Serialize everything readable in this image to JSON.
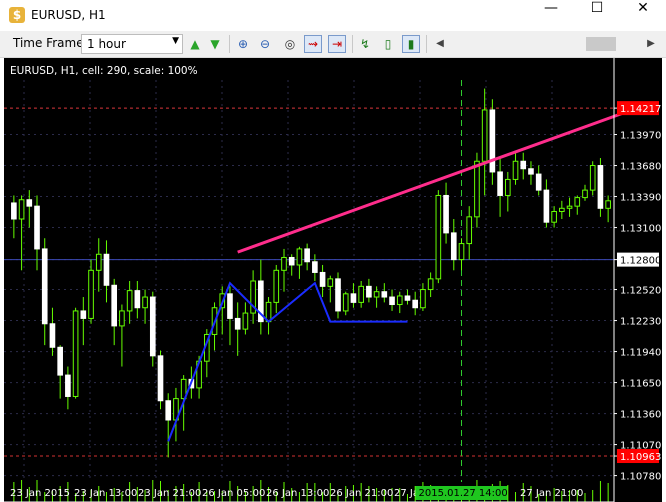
{
  "window": {
    "title": "EURUSD, H1",
    "app_icon": "dollar-coin-icon",
    "controls": [
      "minimize",
      "maximize",
      "close"
    ]
  },
  "toolbar": {
    "time_frame_label": "Time Frame:",
    "time_frame_value": "1 hour",
    "icons": [
      "arrow-up-green-icon",
      "arrow-down-green-icon",
      "zoom-in-icon",
      "zoom-out-icon",
      "binoculars-icon",
      "chart-shift-icon",
      "autoscroll-icon",
      "line-chart-icon",
      "bar-chart-icon",
      "candlestick-chart-icon",
      "scroll-left-icon",
      "scroll-right-icon"
    ]
  },
  "chart": {
    "header": "EURUSD, H1, cell: 290, scale: 100%",
    "price_labels": [
      "1.14217",
      "1.13970",
      "1.13680",
      "1.13390",
      "1.13100",
      "1.12800",
      "1.12520",
      "1.12230",
      "1.11940",
      "1.11650",
      "1.11360",
      "1.11070",
      "1.10963",
      "1.10780"
    ],
    "highlighted_prices": {
      "top": "1.14217",
      "bottom": "1.10963",
      "current": "1.12800"
    },
    "time_labels": [
      "23 Jan 2015",
      "23 Jan 13:00",
      "23 Jan 21:00",
      "26 Jan 05:00",
      "26 Jan 13:00",
      "26 Jan 21:00",
      "27 Jan",
      "27 Jan 21:00"
    ],
    "crosshair_time": "2015.01.27 14:00",
    "colors": {
      "background": "#000000",
      "candle": "#66ff00",
      "trendline": "#ff2d8c",
      "drawing": "#1a2cff",
      "hline_red": "#d23232",
      "hline_blue": "#3c4ab4",
      "crosshair": "#2ecc2e",
      "price_highlight_red": "#ff0000",
      "price_highlight_white": "#ffffff"
    }
  },
  "chart_data": {
    "type": "candlestick",
    "symbol": "EURUSD",
    "timeframe": "H1",
    "ylim": [
      1.1072,
      1.1448
    ],
    "candles": [
      [
        1.1333,
        1.134,
        1.13,
        1.1318
      ],
      [
        1.1318,
        1.134,
        1.127,
        1.1336
      ],
      [
        1.1336,
        1.1345,
        1.131,
        1.133
      ],
      [
        1.133,
        1.134,
        1.127,
        1.129
      ],
      [
        1.129,
        1.13,
        1.12,
        1.122
      ],
      [
        1.122,
        1.1235,
        1.119,
        1.1198
      ],
      [
        1.1198,
        1.12,
        1.115,
        1.1172
      ],
      [
        1.1172,
        1.118,
        1.114,
        1.1152
      ],
      [
        1.1152,
        1.1235,
        1.115,
        1.1232
      ],
      [
        1.1232,
        1.1245,
        1.12,
        1.1225
      ],
      [
        1.1225,
        1.128,
        1.122,
        1.127
      ],
      [
        1.127,
        1.13,
        1.125,
        1.1285
      ],
      [
        1.1285,
        1.1298,
        1.124,
        1.1256
      ],
      [
        1.1256,
        1.1262,
        1.12,
        1.1218
      ],
      [
        1.1218,
        1.1238,
        1.118,
        1.1232
      ],
      [
        1.1232,
        1.126,
        1.122,
        1.1251
      ],
      [
        1.1251,
        1.126,
        1.1225,
        1.1235
      ],
      [
        1.1235,
        1.1252,
        1.122,
        1.1245
      ],
      [
        1.1245,
        1.125,
        1.118,
        1.119
      ],
      [
        1.119,
        1.1195,
        1.114,
        1.1148
      ],
      [
        1.1148,
        1.1155,
        1.1095,
        1.113
      ],
      [
        1.113,
        1.116,
        1.111,
        1.115
      ],
      [
        1.115,
        1.1172,
        1.112,
        1.1168
      ],
      [
        1.1168,
        1.118,
        1.115,
        1.116
      ],
      [
        1.116,
        1.119,
        1.115,
        1.1185
      ],
      [
        1.1185,
        1.1215,
        1.117,
        1.121
      ],
      [
        1.121,
        1.124,
        1.1195,
        1.1235
      ],
      [
        1.1235,
        1.1255,
        1.121,
        1.1248
      ],
      [
        1.1248,
        1.1255,
        1.12,
        1.1225
      ],
      [
        1.1225,
        1.124,
        1.119,
        1.1215
      ],
      [
        1.1215,
        1.124,
        1.121,
        1.123
      ],
      [
        1.123,
        1.127,
        1.122,
        1.126
      ],
      [
        1.126,
        1.128,
        1.121,
        1.1222
      ],
      [
        1.1222,
        1.1245,
        1.121,
        1.124
      ],
      [
        1.124,
        1.1275,
        1.123,
        1.127
      ],
      [
        1.127,
        1.129,
        1.125,
        1.1282
      ],
      [
        1.1282,
        1.1285,
        1.1265,
        1.1275
      ],
      [
        1.1275,
        1.1292,
        1.1262,
        1.129
      ],
      [
        1.129,
        1.1295,
        1.127,
        1.1278
      ],
      [
        1.1278,
        1.1285,
        1.126,
        1.1268
      ],
      [
        1.1268,
        1.1275,
        1.1245,
        1.1255
      ],
      [
        1.1255,
        1.1265,
        1.124,
        1.1262
      ],
      [
        1.1262,
        1.1268,
        1.1225,
        1.1232
      ],
      [
        1.1232,
        1.125,
        1.1228,
        1.1248
      ],
      [
        1.1248,
        1.1258,
        1.1235,
        1.124
      ],
      [
        1.124,
        1.126,
        1.1235,
        1.1255
      ],
      [
        1.1255,
        1.1262,
        1.124,
        1.1245
      ],
      [
        1.1245,
        1.1255,
        1.1235,
        1.125
      ],
      [
        1.125,
        1.1258,
        1.124,
        1.1245
      ],
      [
        1.1245,
        1.1252,
        1.1232,
        1.1238
      ],
      [
        1.1238,
        1.125,
        1.123,
        1.1246
      ],
      [
        1.1246,
        1.1252,
        1.1238,
        1.1242
      ],
      [
        1.1242,
        1.125,
        1.1228,
        1.1235
      ],
      [
        1.1235,
        1.1258,
        1.1232,
        1.1252
      ],
      [
        1.1252,
        1.1268,
        1.1245,
        1.1262
      ],
      [
        1.1262,
        1.1345,
        1.1258,
        1.134
      ],
      [
        1.134,
        1.1352,
        1.1295,
        1.1305
      ],
      [
        1.1305,
        1.1318,
        1.127,
        1.128
      ],
      [
        1.128,
        1.13,
        1.127,
        1.1295
      ],
      [
        1.1295,
        1.133,
        1.128,
        1.132
      ],
      [
        1.132,
        1.138,
        1.131,
        1.1372
      ],
      [
        1.1372,
        1.144,
        1.134,
        1.142
      ],
      [
        1.142,
        1.143,
        1.135,
        1.1362
      ],
      [
        1.1362,
        1.1375,
        1.132,
        1.134
      ],
      [
        1.134,
        1.1362,
        1.1325,
        1.1355
      ],
      [
        1.1355,
        1.138,
        1.135,
        1.1372
      ],
      [
        1.1372,
        1.138,
        1.1355,
        1.1365
      ],
      [
        1.1365,
        1.1372,
        1.135,
        1.136
      ],
      [
        1.136,
        1.1368,
        1.134,
        1.1345
      ],
      [
        1.1345,
        1.1355,
        1.131,
        1.1315
      ],
      [
        1.1315,
        1.133,
        1.131,
        1.1325
      ],
      [
        1.1325,
        1.1335,
        1.1318,
        1.1328
      ],
      [
        1.1328,
        1.1338,
        1.132,
        1.133
      ],
      [
        1.133,
        1.134,
        1.1322,
        1.1338
      ],
      [
        1.1338,
        1.135,
        1.1335,
        1.1345
      ],
      [
        1.1345,
        1.1372,
        1.134,
        1.1368
      ],
      [
        1.1368,
        1.1375,
        1.132,
        1.1328
      ],
      [
        1.1328,
        1.134,
        1.1315,
        1.1335
      ]
    ],
    "trendline": [
      [
        29,
        1.1287
      ],
      [
        82,
        1.1425
      ]
    ],
    "drawing_polyline": [
      [
        20,
        1.111
      ],
      [
        28,
        1.1258
      ],
      [
        33,
        1.1222
      ],
      [
        39,
        1.1258
      ],
      [
        41,
        1.1222
      ],
      [
        51,
        1.1222
      ]
    ]
  }
}
